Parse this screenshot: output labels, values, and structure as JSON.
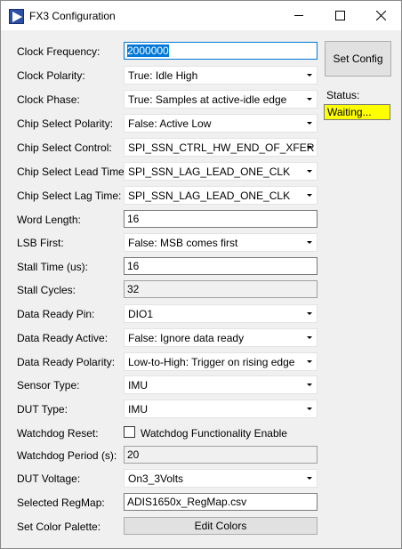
{
  "window": {
    "title": "FX3 Configuration",
    "controls": [
      "minimize",
      "maximize",
      "close"
    ]
  },
  "fields": {
    "clock_frequency": {
      "label": "Clock Frequency:",
      "value": "2000000"
    },
    "clock_polarity": {
      "label": "Clock Polarity:",
      "value": "True: Idle High"
    },
    "clock_phase": {
      "label": "Clock Phase:",
      "value": "True: Samples at active-idle edge"
    },
    "chip_select_polarity": {
      "label": "Chip Select Polarity:",
      "value": "False: Active Low"
    },
    "chip_select_control": {
      "label": "Chip Select Control:",
      "value": "SPI_SSN_CTRL_HW_END_OF_XFER"
    },
    "chip_select_lead_time": {
      "label": "Chip Select Lead Time:",
      "value": "SPI_SSN_LAG_LEAD_ONE_CLK"
    },
    "chip_select_lag_time": {
      "label": "Chip Select Lag Time:",
      "value": "SPI_SSN_LAG_LEAD_ONE_CLK"
    },
    "word_length": {
      "label": "Word Length:",
      "value": "16"
    },
    "lsb_first": {
      "label": "LSB First:",
      "value": "False: MSB comes first"
    },
    "stall_time": {
      "label": "Stall Time (us):",
      "value": "16"
    },
    "stall_cycles": {
      "label": "Stall Cycles:",
      "value": "32"
    },
    "data_ready_pin": {
      "label": "Data Ready Pin:",
      "value": "DIO1"
    },
    "data_ready_active": {
      "label": "Data Ready Active:",
      "value": "False: Ignore data ready"
    },
    "data_ready_polarity": {
      "label": "Data Ready Polarity:",
      "value": "Low-to-High: Trigger on rising edge"
    },
    "sensor_type": {
      "label": "Sensor Type:",
      "value": "IMU"
    },
    "dut_type": {
      "label": "DUT Type:",
      "value": "IMU"
    },
    "watchdog_reset": {
      "label": "Watchdog Reset:",
      "checkbox_label": "Watchdog Functionality Enable",
      "checked": false
    },
    "watchdog_period": {
      "label": "Watchdog Period (s):",
      "value": "20"
    },
    "dut_voltage": {
      "label": "DUT Voltage:",
      "value": "On3_3Volts"
    },
    "selected_regmap": {
      "label": "Selected RegMap:",
      "value": "ADIS1650x_RegMap.csv"
    },
    "set_color_palette": {
      "label": "Set Color Palette:",
      "button": "Edit Colors"
    }
  },
  "side": {
    "set_config_button": "Set Config",
    "status_label": "Status:",
    "status_value": "Waiting...",
    "status_color": "#ffff00"
  }
}
